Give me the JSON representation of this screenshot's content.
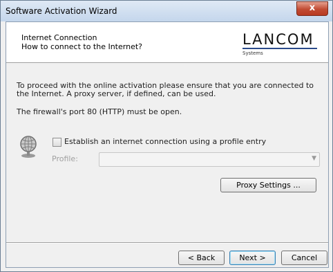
{
  "window": {
    "title": "Software Activation Wizard",
    "close_label": "x"
  },
  "header": {
    "title": "Internet Connection",
    "subtitle": "How to connect to the Internet?",
    "logo_text": "LANCOM",
    "logo_subtext": "Systems"
  },
  "body": {
    "info_line1": "To proceed with the online activation please ensure that you are connected to the Internet. A proxy server, if defined, can be used.",
    "info_line2": "The firewall's port 80 (HTTP) must be open.",
    "checkbox_label": "Establish an internet connection using a profile entry",
    "checkbox_checked": false,
    "profile_label": "Profile:",
    "profile_value": "",
    "proxy_button": "Proxy Settings ..."
  },
  "footer": {
    "back_label": "< Back",
    "next_label": "Next >",
    "cancel_label": "Cancel"
  }
}
